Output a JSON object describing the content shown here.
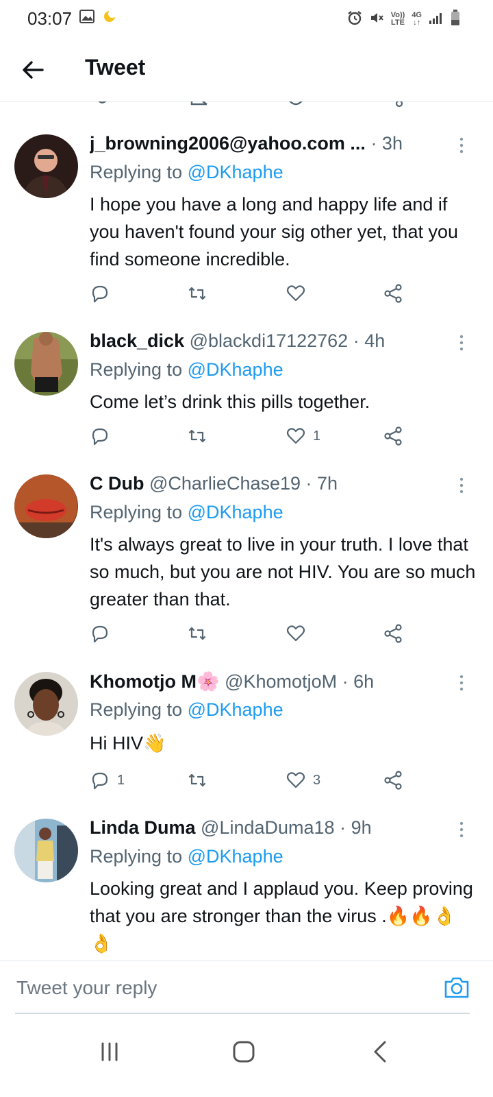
{
  "status": {
    "time": "03:07",
    "net_top": "Vo))",
    "net_bottom": "LTE",
    "gen": "4G"
  },
  "header": {
    "title": "Tweet"
  },
  "colors": {
    "link": "#1d9bf0",
    "muted": "#536471",
    "text": "#0f1419",
    "divider": "#e6ecf0"
  },
  "tweets": [
    {
      "name": "j_browning2006@yahoo.com ...",
      "handle": "",
      "time": "· 3h",
      "replying_prefix": "Replying to",
      "replying_handle": "@DKhaphe",
      "text": "I hope you have a long and happy life and if you haven't found your sig other yet, that you find someone incredible.",
      "reply_count": "",
      "like_count": ""
    },
    {
      "name": "black_dick",
      "handle": "@blackdi17122762",
      "time": "· 4h",
      "replying_prefix": "Replying to",
      "replying_handle": "@DKhaphe",
      "text": "Come let’s drink this pills together.",
      "reply_count": "",
      "like_count": "1"
    },
    {
      "name": "C Dub",
      "handle": "@CharlieChase19",
      "time": "· 7h",
      "replying_prefix": "Replying to",
      "replying_handle": "@DKhaphe",
      "text": "It's always great to live in your truth. I love that so much, but you are not HIV. You are so much greater than that.",
      "reply_count": "",
      "like_count": ""
    },
    {
      "name": "Khomotjo M🌸",
      "handle": "@KhomotjoM",
      "time": "· 6h",
      "replying_prefix": "Replying to",
      "replying_handle": "@DKhaphe",
      "text": "Hi HIV👋",
      "reply_count": "1",
      "like_count": "3"
    },
    {
      "name": "Linda Duma",
      "handle": "@LindaDuma18",
      "time": "· 9h",
      "replying_prefix": "Replying to",
      "replying_handle": "@DKhaphe",
      "text": "Looking great and I applaud you. Keep proving that you are stronger than the virus .🔥🔥👌👌",
      "reply_count": "",
      "like_count": ""
    }
  ],
  "reply_bar": {
    "placeholder": "Tweet your reply"
  }
}
